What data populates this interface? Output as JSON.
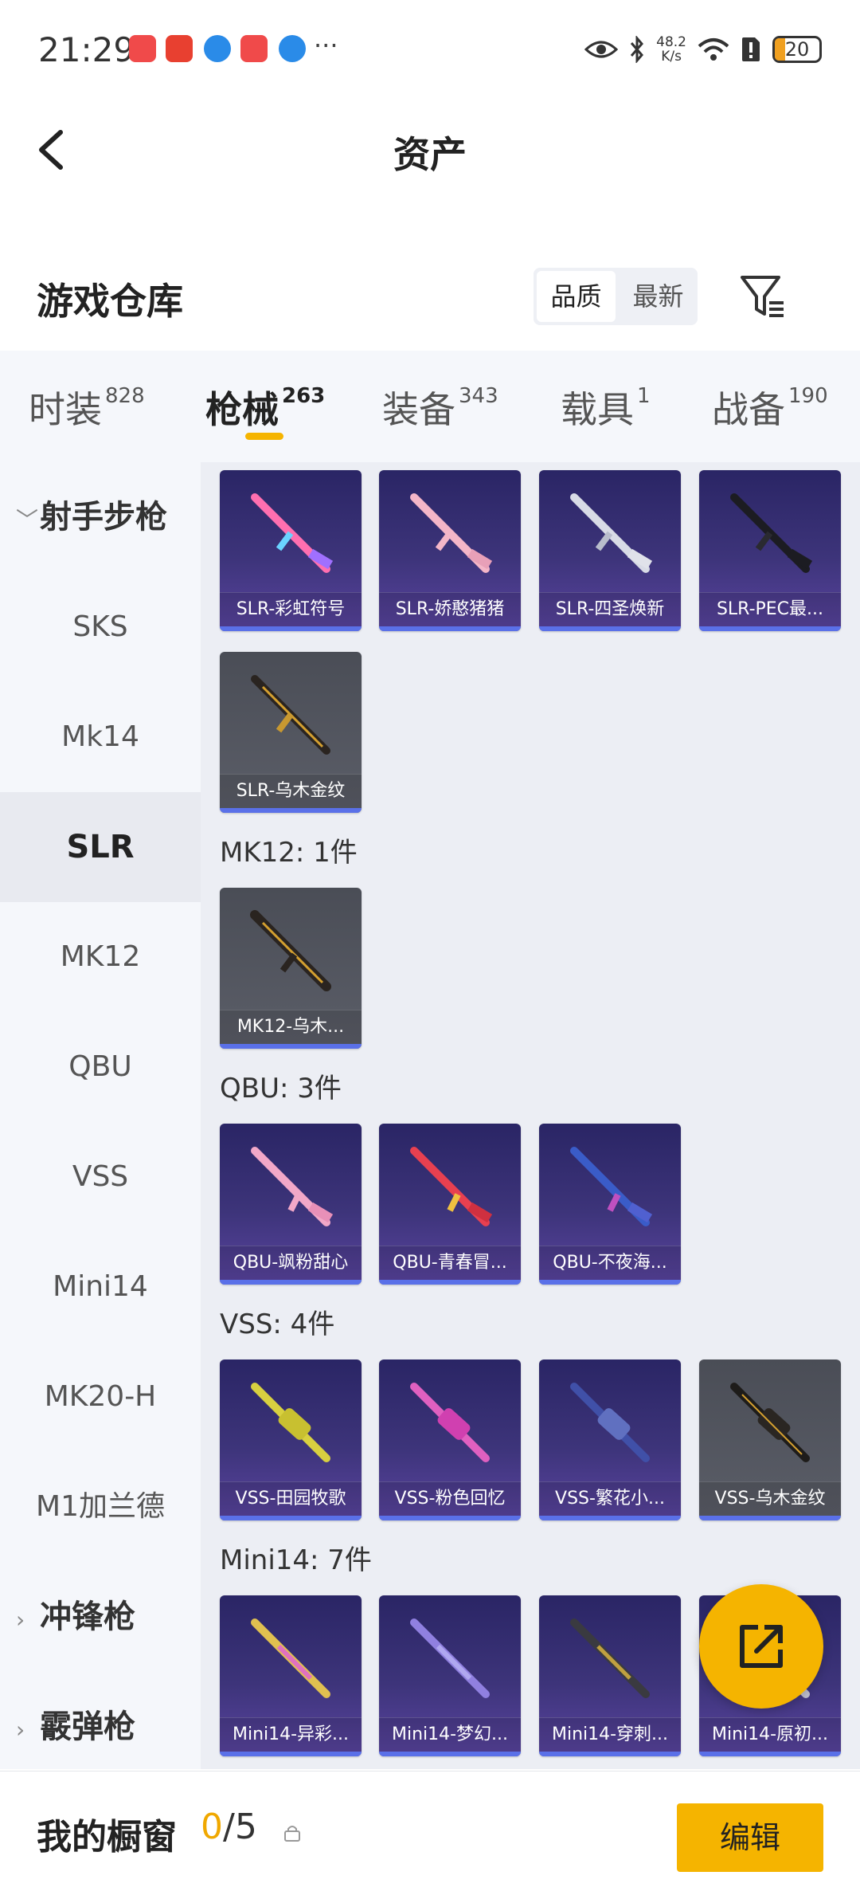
{
  "status_bar": {
    "time": "21:29",
    "more": "···",
    "net_speed": "48.2",
    "net_unit": "K/s",
    "battery": "20"
  },
  "nav": {
    "title": "资产"
  },
  "warehouse": {
    "title": "游戏仓库",
    "sort_options": [
      "品质",
      "最新"
    ],
    "active_sort": "品质"
  },
  "tabs": [
    {
      "label": "时装",
      "count": "828"
    },
    {
      "label": "枪械",
      "count": "263"
    },
    {
      "label": "装备",
      "count": "343"
    },
    {
      "label": "载具",
      "count": "1"
    },
    {
      "label": "战备",
      "count": "190"
    }
  ],
  "active_tab": "枪械",
  "sidebar": {
    "group_rifles": "射手步枪",
    "items": [
      "SKS",
      "Mk14",
      "SLR",
      "MK12",
      "QBU",
      "VSS",
      "Mini14",
      "MK20-H",
      "M1加兰德"
    ],
    "active_item": "SLR",
    "group_smg": "冲锋枪",
    "group_shotgun": "霰弹枪"
  },
  "sections": {
    "slr": {
      "items": [
        "SLR-彩虹符号",
        "SLR-娇憨猪猪",
        "SLR-四圣焕新",
        "SLR-PEC最...",
        "SLR-乌木金纹"
      ]
    },
    "mk12": {
      "title": "MK12: 1件",
      "items": [
        "MK12-乌木..."
      ]
    },
    "qbu": {
      "title": "QBU: 3件",
      "items": [
        "QBU-飒粉甜心",
        "QBU-青春冒...",
        "QBU-不夜海..."
      ]
    },
    "vss": {
      "title": "VSS: 4件",
      "items": [
        "VSS-田园牧歌",
        "VSS-粉色回忆",
        "VSS-繁花小...",
        "VSS-乌木金纹"
      ]
    },
    "mini14": {
      "title": "Mini14: 7件",
      "items": [
        "Mini14-异彩...",
        "Mini14-梦幻...",
        "Mini14-穿刺...",
        "Mini14-原初..."
      ]
    }
  },
  "bottom": {
    "showcase_label": "我的橱窗",
    "count_current": "0",
    "count_total": "/5",
    "edit_label": "编辑"
  },
  "colors": {
    "accent": "#f5b400",
    "card_purple": "#3d347a",
    "card_gray": "#5b5e68",
    "rarity_bar": "#5a70e8"
  }
}
